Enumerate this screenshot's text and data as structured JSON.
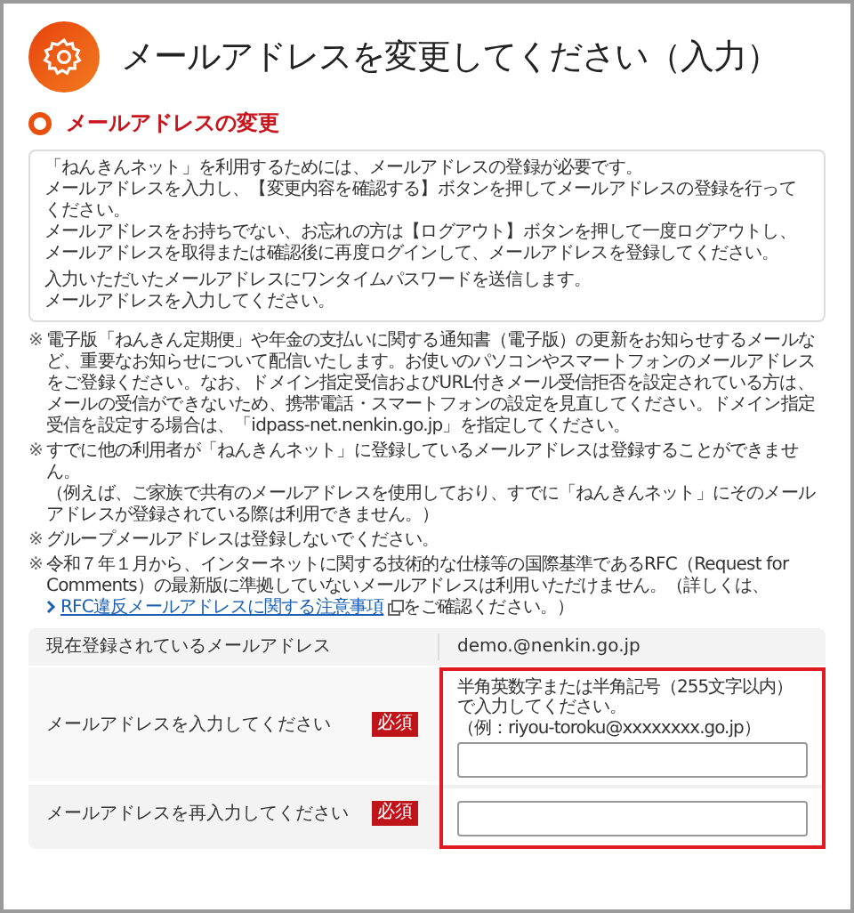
{
  "title": "メールアドレスを変更してください（入力）",
  "section_heading": "メールアドレスの変更",
  "info_box": {
    "paragraphs": [
      [
        "「ねんきんネット」を利用するためには、メールアドレスの登録が必要です。",
        "メールアドレスを入力し、【変更内容を確認する】ボタンを押してメールアドレスの登録を行ってください。",
        "メールアドレスをお持ちでない、お忘れの方は【ログアウト】ボタンを押して一度ログアウトし、メールアドレスを取得または確認後に再度ログインして、メールアドレスを登録してください。"
      ],
      [
        "入力いただいたメールアドレスにワンタイムパスワードを送信します。",
        "メールアドレスを入力してください。"
      ]
    ]
  },
  "notes": [
    {
      "kind": "plain",
      "mark": "※",
      "lines": [
        "電子版「ねんきん定期便」や年金の支払いに関する通知書（電子版）の更新をお知らせするメールなど、重要なお知らせについて配信いたします。お使いのパソコンやスマートフォンのメールアドレスをご登録ください。なお、ドメイン指定受信およびURL付きメール受信拒否を設定されている方は、メールの受信ができないため、携帯電話・スマートフォンの設定を見直してください。ドメイン指定受信を設定する場合は、「idpass-net.nenkin.go.jp」を指定してください。"
      ]
    },
    {
      "kind": "plain",
      "mark": "※",
      "lines": [
        "すでに他の利用者が「ねんきんネット」に登録しているメールアドレスは登録することができません。",
        "（例えば、ご家族で共有のメールアドレスを使用しており、すでに「ねんきんネット」にそのメールアドレスが登録されている際は利用できません。）"
      ]
    },
    {
      "kind": "plain",
      "mark": "※",
      "lines": [
        "グループメールアドレスは登録しないでください。"
      ]
    },
    {
      "kind": "link",
      "mark": "※",
      "before": "令和７年１月から、インターネットに関する技術的な仕様等の国際基準であるRFC（Request for Comments）の最新版に準拠していないメールアドレスは利用いただけません。（詳しくは、",
      "link": "RFC違反メールアドレスに関する注意事項",
      "after": "をご確認ください。）"
    }
  ],
  "current": {
    "label": "現在登録されているメールアドレス",
    "value": "demo.@nenkin.go.jp"
  },
  "fields": [
    {
      "label": "メールアドレスを入力してください",
      "badge": "必須",
      "hint_lines": [
        "半角英数字または半角記号（255文字以内）で入力してください。",
        "（例：riyou-toroku@xxxxxxxx.go.jp）"
      ]
    },
    {
      "label": "メールアドレスを再入力してください",
      "badge": "必須"
    }
  ]
}
